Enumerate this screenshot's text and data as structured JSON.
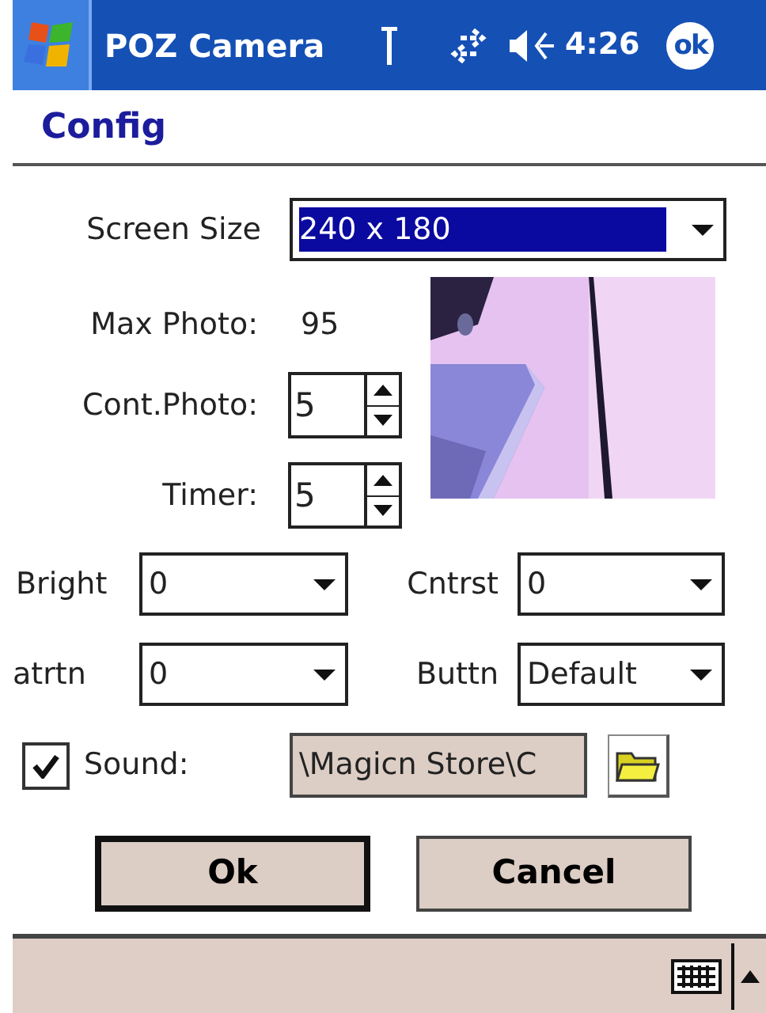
{
  "title_bar": {
    "title": "POZ Camera",
    "time": "4:26",
    "ok_label": "ok"
  },
  "header": {
    "title": "Config"
  },
  "screen_size": {
    "label": "Screen Size",
    "value": "240 x 180",
    "selected": true
  },
  "max_photo": {
    "label": "Max Photo:",
    "value": "95"
  },
  "spinners": [
    {
      "label": "Cont.Photo:",
      "value": "5"
    },
    {
      "label": "Timer:",
      "value": "5"
    }
  ],
  "adjustments": [
    {
      "label": "Bright",
      "value": "0"
    },
    {
      "label": "Cntrst",
      "value": "0"
    },
    {
      "label": "atrtn",
      "value": "0"
    },
    {
      "label": "Buttn",
      "value": "Default"
    }
  ],
  "sound": {
    "label": "Sound:",
    "checked": true,
    "path": "\\Magicn Store\\C"
  },
  "buttons": [
    {
      "label": "Ok",
      "default": true
    },
    {
      "label": "Cancel",
      "default": false
    }
  ]
}
